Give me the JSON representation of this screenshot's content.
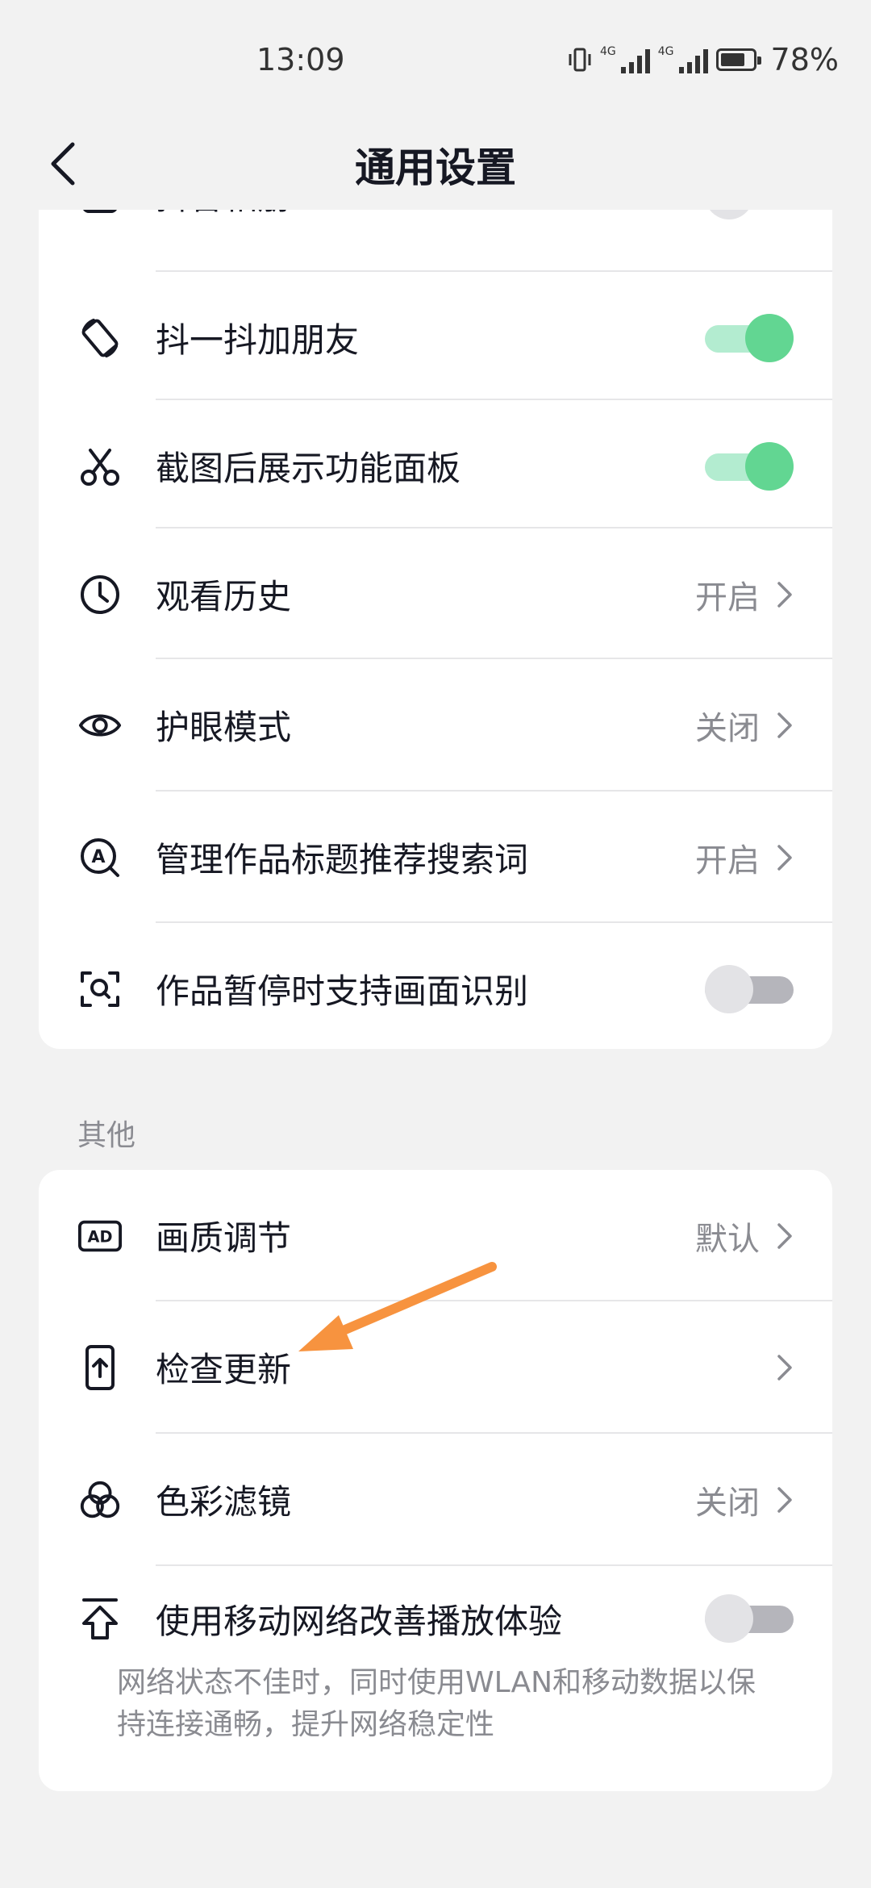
{
  "status_bar": {
    "time": "13:09",
    "network1": "4G",
    "network2": "4G",
    "battery_pct": "78%",
    "battery_level": 0.78
  },
  "nav": {
    "title": "通用设置"
  },
  "group1": {
    "rows": [
      {
        "label": "抖音相册",
        "icon": "album-icon",
        "type": "toggle",
        "on": false
      },
      {
        "label": "抖一抖加朋友",
        "icon": "shake-icon",
        "type": "toggle",
        "on": true
      },
      {
        "label": "截图后展示功能面板",
        "icon": "scissors-icon",
        "type": "toggle",
        "on": true
      },
      {
        "label": "观看历史",
        "icon": "clock-icon",
        "type": "link",
        "value": "开启"
      },
      {
        "label": "护眼模式",
        "icon": "eye-icon",
        "type": "link",
        "value": "关闭"
      },
      {
        "label": "管理作品标题推荐搜索词",
        "icon": "search-a-icon",
        "type": "link",
        "value": "开启"
      },
      {
        "label": "作品暂停时支持画面识别",
        "icon": "scan-icon",
        "type": "toggle",
        "on": false
      }
    ]
  },
  "section_other": {
    "title": "其他",
    "rows": [
      {
        "label": "画质调节",
        "icon": "ad-icon",
        "type": "link",
        "value": "默认"
      },
      {
        "label": "检查更新",
        "icon": "phone-upload-icon",
        "type": "link",
        "value": ""
      },
      {
        "label": "色彩滤镜",
        "icon": "color-filter-icon",
        "type": "link",
        "value": "关闭"
      },
      {
        "label": "使用移动网络改善播放体验",
        "icon": "upload-arrow-icon",
        "type": "toggle",
        "on": false,
        "description": "网络状态不佳时，同时使用WLAN和移动数据以保持连接通畅，提升网络稳定性"
      }
    ]
  },
  "colors": {
    "toggle_on": "#62d692",
    "toggle_off": "#b5b5bb",
    "annotation_arrow": "#f7933f"
  }
}
